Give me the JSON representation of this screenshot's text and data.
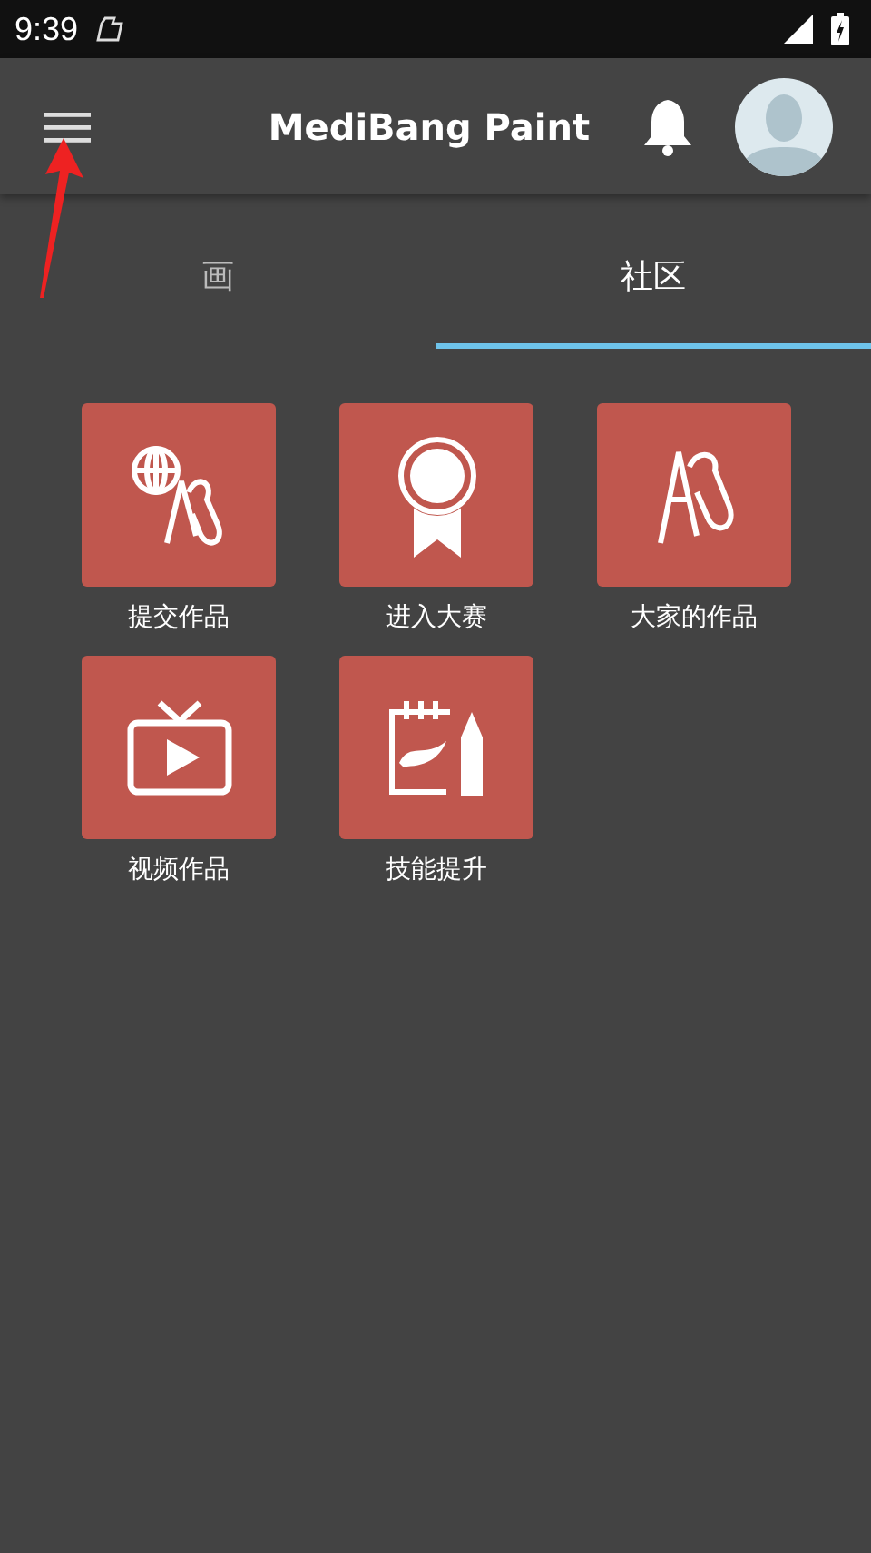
{
  "status_bar": {
    "time": "9:39"
  },
  "app_bar": {
    "title": "MediBang Paint"
  },
  "tabs": [
    {
      "label": "画",
      "selected": false
    },
    {
      "label": "社区",
      "selected": true
    }
  ],
  "tiles": [
    {
      "kind": "submit",
      "label": "提交作品"
    },
    {
      "kind": "contest",
      "label": "进入大赛"
    },
    {
      "kind": "gallery",
      "label": "大家的作品"
    },
    {
      "kind": "video",
      "label": "视频作品"
    },
    {
      "kind": "skills",
      "label": "技能提升"
    }
  ]
}
